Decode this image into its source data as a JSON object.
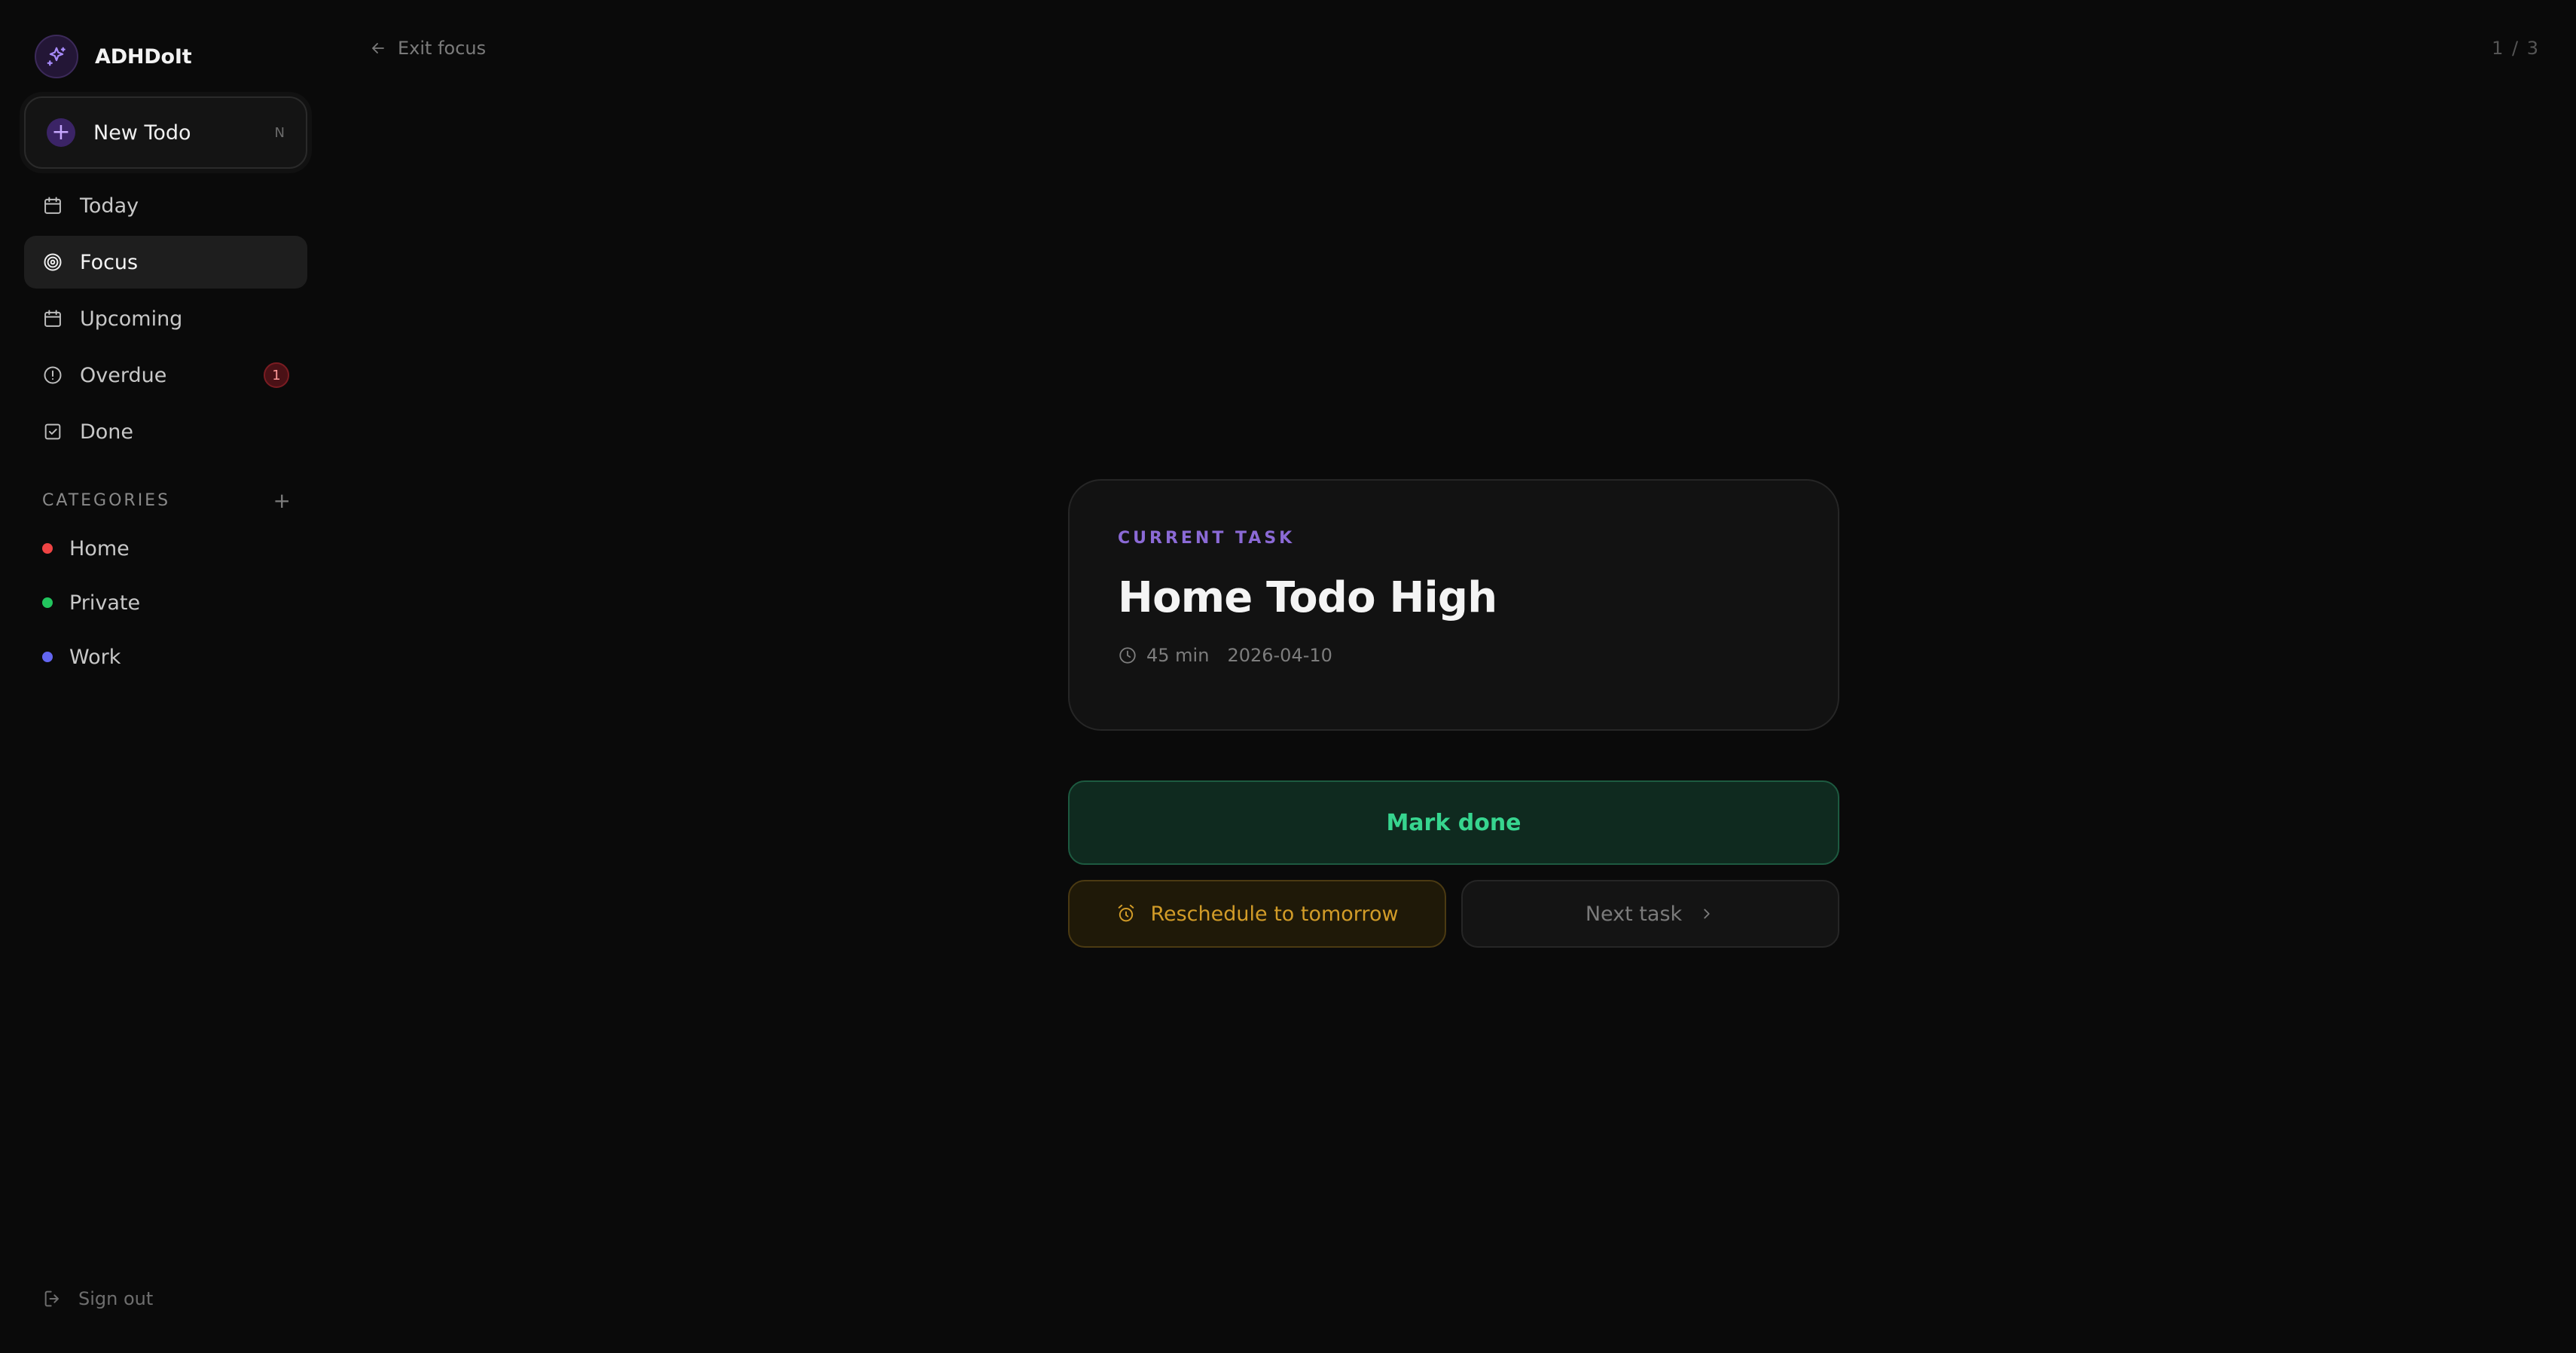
{
  "app": {
    "name": "ADHDoIt"
  },
  "sidebar": {
    "new_todo": {
      "label": "New Todo",
      "shortcut": "N"
    },
    "nav": [
      {
        "label": "Today",
        "icon": "calendar-icon",
        "active": false
      },
      {
        "label": "Focus",
        "icon": "target-icon",
        "active": true
      },
      {
        "label": "Upcoming",
        "icon": "calendar-icon",
        "active": false
      },
      {
        "label": "Overdue",
        "icon": "alert-circle-icon",
        "active": false,
        "badge": "1"
      },
      {
        "label": "Done",
        "icon": "checkbox-icon",
        "active": false
      }
    ],
    "categories_title": "CATEGORIES",
    "categories": [
      {
        "label": "Home",
        "color": "#ef4444"
      },
      {
        "label": "Private",
        "color": "#22c55e"
      },
      {
        "label": "Work",
        "color": "#6366f1"
      }
    ],
    "sign_out": "Sign out"
  },
  "header": {
    "exit_focus": "Exit focus",
    "counter": "1 / 3"
  },
  "task": {
    "eyebrow": "CURRENT TASK",
    "title": "Home Todo High",
    "duration": "45 min",
    "date": "2026-04-10"
  },
  "actions": {
    "mark_done": "Mark done",
    "reschedule": "Reschedule to tomorrow",
    "next_task": "Next task"
  },
  "colors": {
    "accent": "#8b6ad6",
    "success": "#37d58f",
    "warning": "#d29c28",
    "danger": "#ff9a9a"
  }
}
